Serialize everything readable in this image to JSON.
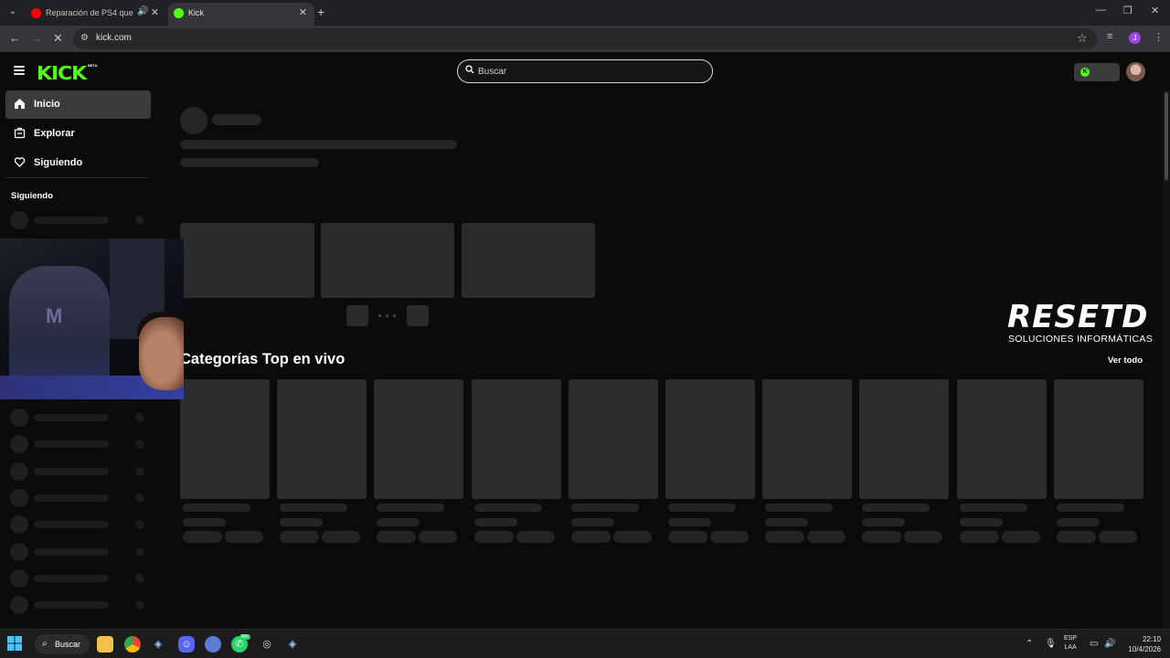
{
  "browser": {
    "tabs": [
      {
        "title": "Reparación de PS4 que no ...",
        "active": false,
        "favicon": "youtube-icon"
      },
      {
        "title": "Kick",
        "active": true,
        "favicon": "kick-icon"
      }
    ],
    "url": "kick.com",
    "profile_initial": "J"
  },
  "kick": {
    "logo": "KICK",
    "logo_badge": "BETA",
    "search_placeholder": "Buscar",
    "nav": [
      {
        "label": "Inicio",
        "icon": "home-icon",
        "active": true
      },
      {
        "label": "Explorar",
        "icon": "compass-icon",
        "active": false
      },
      {
        "label": "Siguiendo",
        "icon": "heart-icon",
        "active": false
      }
    ],
    "following_heading": "Siguiendo",
    "categories_title": "Categorías Top en vivo",
    "see_all": "Ver todo",
    "accent": "#53fc18"
  },
  "watermark": {
    "brand": "RESETD",
    "subtitle": "SOLUCIONES INFORMÁTICAS"
  },
  "taskbar": {
    "search_label": "Buscar",
    "lang_top": "ESP",
    "lang_bottom": "LAA",
    "time": "22:10",
    "date": "10/4/2026",
    "whatsapp_badge": "99+"
  }
}
